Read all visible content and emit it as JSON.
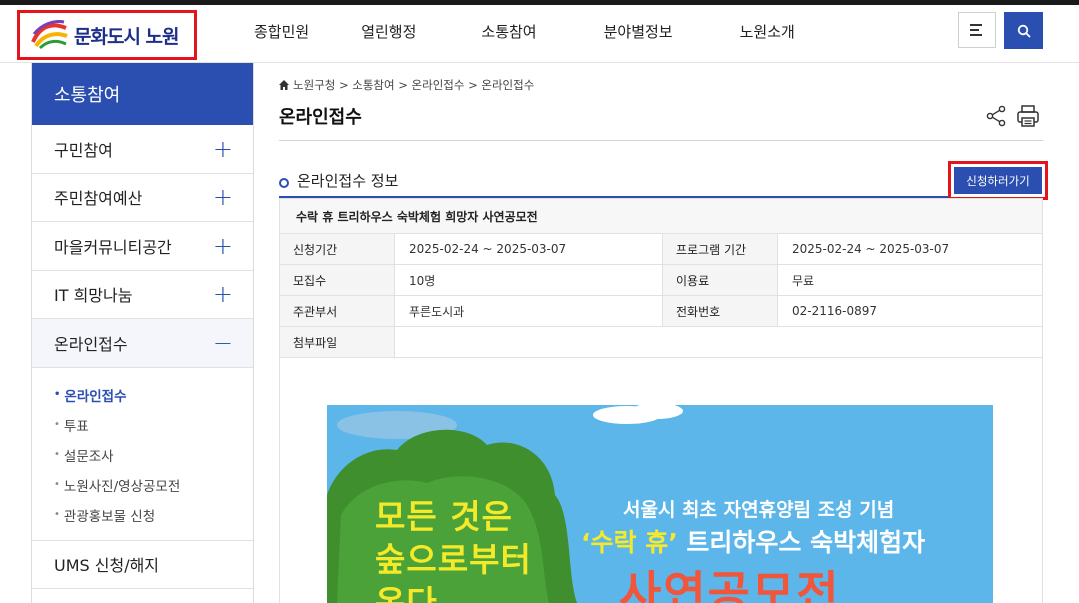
{
  "header": {
    "logo_text": "문화도시 노원",
    "nav": [
      "종합민원",
      "열린행정",
      "소통참여",
      "분야별정보",
      "노원소개"
    ],
    "menu_icon": "hamburger-icon",
    "search_icon": "search-icon"
  },
  "sidebar": {
    "title": "소통참여",
    "items": [
      {
        "label": "구민참여",
        "sign": "+"
      },
      {
        "label": "주민참여예산",
        "sign": "+"
      },
      {
        "label": "마을커뮤니티공간",
        "sign": "+"
      },
      {
        "label": "IT 희망나눔",
        "sign": "+"
      },
      {
        "label": "온라인접수",
        "sign": "−"
      }
    ],
    "sub_items": [
      "온라인접수",
      "투표",
      "설문조사",
      "노원사진/영상공모전",
      "관광홍보물 신청"
    ],
    "last_item": "UMS 신청/해지"
  },
  "breadcrumb": "노원구청 > 소통참여 > 온라인접수 > 온라인접수",
  "page_title": "온라인접수",
  "section": {
    "title": "온라인접수 정보",
    "apply_button": "신청하러가기"
  },
  "info": {
    "subject": "수락 휴 트리하우스 숙박체험 희망자 사연공모전",
    "rows": [
      {
        "l1": "신청기간",
        "v1": "2025-02-24 ~ 2025-03-07",
        "l2": "프로그램 기간",
        "v2": "2025-02-24 ~ 2025-03-07"
      },
      {
        "l1": "모집수",
        "v1": "10명",
        "l2": "이용료",
        "v2": "무료"
      },
      {
        "l1": "주관부서",
        "v1": "푸른도시과",
        "l2": "전화번호",
        "v2": "02-2116-0897"
      }
    ],
    "attach_label": "첨부파일"
  },
  "poster": {
    "left_line1": "모든 것은",
    "left_line2": "숲으로부터",
    "left_line3": "온다",
    "sub1": "서울시 최초 자연휴양림 조성 기념",
    "sub2_quote": "‘수락 휴’",
    "sub2_rest": " 트리하우스 숙박체험자",
    "big": "사연공모전"
  },
  "colors": {
    "brand": "#2a4fb0",
    "highlight": "#e3141b"
  }
}
